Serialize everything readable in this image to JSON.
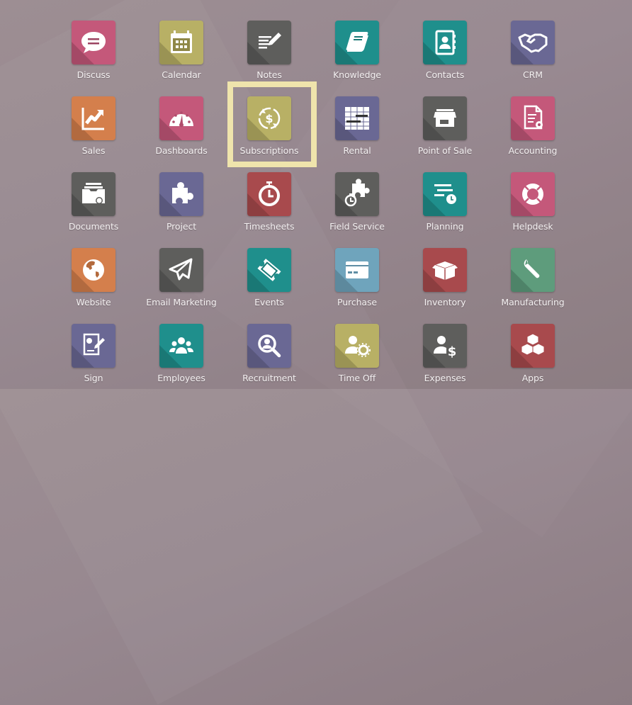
{
  "highlight": {
    "app": "Subscriptions",
    "color": "#efe4ac"
  },
  "apps": [
    {
      "label": "Discuss",
      "icon": "chat-bubble-icon",
      "color": "#c4587a"
    },
    {
      "label": "Calendar",
      "icon": "calendar-icon",
      "color": "#b8b065"
    },
    {
      "label": "Notes",
      "icon": "notes-pencil-icon",
      "color": "#5e5e5c"
    },
    {
      "label": "Knowledge",
      "icon": "book-icon",
      "color": "#1f8f8c"
    },
    {
      "label": "Contacts",
      "icon": "address-book-icon",
      "color": "#1f8f8c"
    },
    {
      "label": "CRM",
      "icon": "handshake-icon",
      "color": "#6a6894"
    },
    {
      "label": "Sales",
      "icon": "trend-chart-icon",
      "color": "#d47f4c"
    },
    {
      "label": "Dashboards",
      "icon": "gauge-icon",
      "color": "#c4587a"
    },
    {
      "label": "Subscriptions",
      "icon": "recurring-dollar-icon",
      "color": "#b8b065"
    },
    {
      "label": "Rental",
      "icon": "rental-grid-icon",
      "color": "#6a6894"
    },
    {
      "label": "Point of Sale",
      "icon": "store-icon",
      "color": "#5e5e5c"
    },
    {
      "label": "Accounting",
      "icon": "document-gear-icon",
      "color": "#c4587a"
    },
    {
      "label": "Documents",
      "icon": "archive-check-icon",
      "color": "#5e5e5c"
    },
    {
      "label": "Project",
      "icon": "puzzle-icon",
      "color": "#6a6894"
    },
    {
      "label": "Timesheets",
      "icon": "stopwatch-icon",
      "color": "#a84a4d"
    },
    {
      "label": "Field Service",
      "icon": "puzzle-stopwatch-icon",
      "color": "#5e5e5c"
    },
    {
      "label": "Planning",
      "icon": "planning-clock-icon",
      "color": "#1f8f8c"
    },
    {
      "label": "Helpdesk",
      "icon": "lifebuoy-icon",
      "color": "#c4587a"
    },
    {
      "label": "Website",
      "icon": "globe-icon",
      "color": "#d47f4c"
    },
    {
      "label": "Email Marketing",
      "icon": "paper-plane-icon",
      "color": "#5e5e5c"
    },
    {
      "label": "Events",
      "icon": "ticket-icon",
      "color": "#1f8f8c"
    },
    {
      "label": "Purchase",
      "icon": "credit-card-icon",
      "color": "#6fa4bc"
    },
    {
      "label": "Inventory",
      "icon": "open-box-icon",
      "color": "#a84a4d"
    },
    {
      "label": "Manufacturing",
      "icon": "wrench-icon",
      "color": "#5e9c7c"
    },
    {
      "label": "Sign",
      "icon": "sign-document-icon",
      "color": "#6a6894"
    },
    {
      "label": "Employees",
      "icon": "people-group-icon",
      "color": "#1f8f8c"
    },
    {
      "label": "Recruitment",
      "icon": "magnifier-person-icon",
      "color": "#6a6894"
    },
    {
      "label": "Time Off",
      "icon": "person-gear-icon",
      "color": "#b8b065"
    },
    {
      "label": "Expenses",
      "icon": "person-dollar-icon",
      "color": "#5e5e5c"
    },
    {
      "label": "Apps",
      "icon": "cubes-icon",
      "color": "#a84a4d"
    }
  ]
}
